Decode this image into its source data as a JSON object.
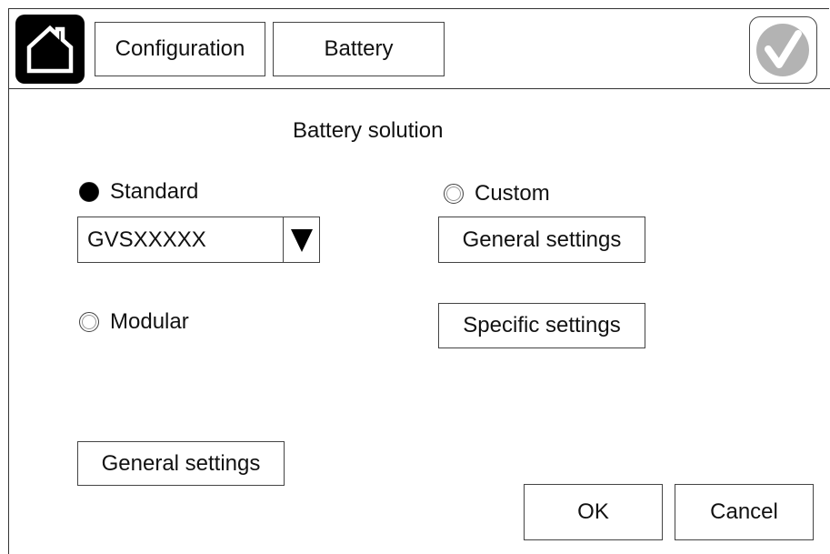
{
  "header": {
    "tabs": [
      {
        "label": "Configuration"
      },
      {
        "label": "Battery"
      }
    ],
    "home_icon": "home-icon",
    "status_icon": "checkmark-icon"
  },
  "main": {
    "title": "Battery solution",
    "options": {
      "standard": {
        "label": "Standard",
        "selected": true
      },
      "custom": {
        "label": "Custom",
        "selected": false
      },
      "modular": {
        "label": "Modular",
        "selected": false
      }
    },
    "model_select": {
      "value": "GVSXXXXX"
    },
    "custom_general_button": "General settings",
    "specific_button": "Specific settings",
    "general_button": "General settings"
  },
  "footer": {
    "ok_label": "OK",
    "cancel_label": "Cancel"
  },
  "colors": {
    "check_badge": "#b3b3b3",
    "home_bg": "#000000"
  }
}
